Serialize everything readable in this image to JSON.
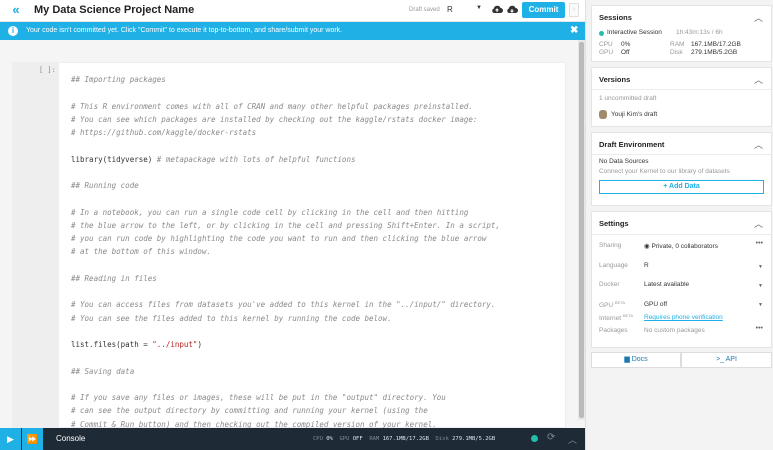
{
  "header": {
    "collapse_icon": "double-chevron-left-icon",
    "title": "My Data Science Project Name",
    "draft_status": "Draft saved",
    "language": "R",
    "commit_label": "Commit"
  },
  "banner": {
    "text": "Your code isn't committed yet. Click \"Commit\" to execute it top-to-bottom, and share/submit your work."
  },
  "cell": {
    "prompt": "[ ]:",
    "lines": [
      {
        "type": "comment",
        "text": "## Importing packages"
      },
      {
        "type": "blank",
        "text": ""
      },
      {
        "type": "comment",
        "text": "# This R environment comes with all of CRAN and many other helpful packages preinstalled."
      },
      {
        "type": "comment",
        "text": "# You can see which packages are installed by checking out the kaggle/rstats docker image:"
      },
      {
        "type": "comment",
        "text": "# https://github.com/kaggle/docker-rstats"
      },
      {
        "type": "blank",
        "text": ""
      },
      {
        "type": "code",
        "code": "library(tidyverse) ",
        "comment": "# metapackage with lots of helpful functions"
      },
      {
        "type": "blank",
        "text": ""
      },
      {
        "type": "comment",
        "text": "## Running code"
      },
      {
        "type": "blank",
        "text": ""
      },
      {
        "type": "comment",
        "text": "# In a notebook, you can run a single code cell by clicking in the cell and then hitting"
      },
      {
        "type": "comment",
        "text": "# the blue arrow to the left, or by clicking in the cell and pressing Shift+Enter. In a script,"
      },
      {
        "type": "comment",
        "text": "# you can run code by highlighting the code you want to run and then clicking the blue arrow"
      },
      {
        "type": "comment",
        "text": "# at the bottom of this window."
      },
      {
        "type": "blank",
        "text": ""
      },
      {
        "type": "comment",
        "text": "## Reading in files"
      },
      {
        "type": "blank",
        "text": ""
      },
      {
        "type": "comment",
        "text": "# You can access files from datasets you've added to this kernel in the \"../input/\" directory."
      },
      {
        "type": "comment",
        "text": "# You can see the files added to this kernel by running the code below."
      },
      {
        "type": "blank",
        "text": ""
      },
      {
        "type": "call",
        "code": "list.files(path = ",
        "string": "\"../input\"",
        "tail": ")"
      },
      {
        "type": "blank",
        "text": ""
      },
      {
        "type": "comment",
        "text": "## Saving data"
      },
      {
        "type": "blank",
        "text": ""
      },
      {
        "type": "comment",
        "text": "# If you save any files or images, these will be put in the \"output\" directory. You"
      },
      {
        "type": "comment",
        "text": "# can see the output directory by committing and running your kernel (using the"
      },
      {
        "type": "comment",
        "text": "# Commit & Run button) and then checking out the compiled version of your kernel."
      }
    ]
  },
  "bottom_bar": {
    "console_label": "Console",
    "cpu_label": "CPU",
    "cpu_value": "0%",
    "gpu_label": "GPU",
    "gpu_value": "OFF",
    "ram_label": "RAM",
    "ram_value": "167.1MB/17.2GB",
    "disk_label": "Disk",
    "disk_value": "279.1MB/5.2GB"
  },
  "sidebar": {
    "sessions": {
      "title": "Sessions",
      "session_name": "Interactive Session",
      "session_time": "1h:43m:13s / 6h",
      "cpu_label": "CPU",
      "cpu_value": "0%",
      "gpu_label": "GPU",
      "gpu_value": "Off",
      "ram_label": "RAM",
      "ram_value": "167.1MB/17.2GB",
      "disk_label": "Disk",
      "disk_value": "279.1MB/5.2GB"
    },
    "versions": {
      "title": "Versions",
      "uncommitted": "1 uncommitted draft",
      "draft_owner": "Youji Kim's draft"
    },
    "draft_env": {
      "title": "Draft Environment",
      "no_sources": "No Data Sources",
      "hint": "Connect your Kernel to our library of datasets",
      "add_data_label": "+ Add Data"
    },
    "settings": {
      "title": "Settings",
      "sharing_label": "Sharing",
      "sharing_value": "Private, 0 collaborators",
      "language_label": "Language",
      "language_value": "R",
      "docker_label": "Docker",
      "docker_value": "Latest available",
      "gpu_label": "GPU",
      "gpu_beta": "BETA",
      "gpu_value": "GPU off",
      "internet_label": "Internet",
      "internet_beta": "BETA",
      "internet_value": "Requires phone verification",
      "packages_label": "Packages",
      "packages_value": "No custom packages"
    },
    "docs_label": "Docs",
    "api_label": ">_ API"
  },
  "colors": {
    "accent": "#1fb0e6",
    "bottom_bar": "#1e2a36",
    "status_green": "#20beaa"
  }
}
